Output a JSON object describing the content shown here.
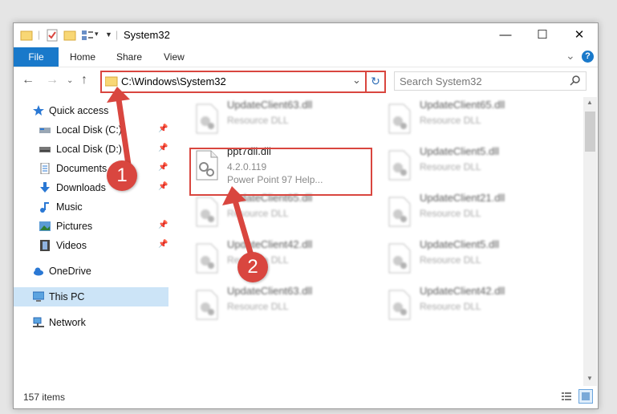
{
  "window": {
    "title": "System32",
    "controls": {
      "minimize": "—",
      "maximize": "☐",
      "close": "✕"
    }
  },
  "ribbon": {
    "tabs": [
      "File",
      "Home",
      "Share",
      "View"
    ],
    "help_label": "?",
    "collapse_label": "⌄"
  },
  "nav": {
    "address": "C:\\Windows\\System32",
    "search_placeholder": "Search System32"
  },
  "sidebar": {
    "items": [
      {
        "label": "Quick access",
        "icon": "star-icon"
      },
      {
        "label": "Local Disk (C:)",
        "icon": "drive-icon"
      },
      {
        "label": "Local Disk (D:)",
        "icon": "drive-icon"
      },
      {
        "label": "Documents",
        "icon": "documents-icon"
      },
      {
        "label": "Downloads",
        "icon": "downloads-icon"
      },
      {
        "label": "Music",
        "icon": "music-icon"
      },
      {
        "label": "Pictures",
        "icon": "pictures-icon"
      },
      {
        "label": "Videos",
        "icon": "videos-icon"
      },
      {
        "label": "OneDrive",
        "icon": "cloud-icon"
      },
      {
        "label": "This PC",
        "icon": "computer-icon"
      },
      {
        "label": "Network",
        "icon": "network-icon"
      }
    ]
  },
  "files": [
    {
      "name": "UpdateClient63.dll",
      "type": "Resource DLL"
    },
    {
      "name": "UpdateClient65.dll",
      "type": "Resource DLL"
    },
    {
      "name": "ppt7dll.dll",
      "version": "4.2.0.119",
      "desc": "Power Point 97 Help..."
    },
    {
      "name": "UpdateClient5.dll",
      "type": "Resource DLL"
    },
    {
      "name": "UpdateClient65.dll",
      "type": "Resource DLL"
    },
    {
      "name": "UpdateClient21.dll",
      "type": "Resource DLL"
    },
    {
      "name": "UpdateClient42.dll",
      "type": "Resource DLL"
    },
    {
      "name": "UpdateClient5.dll",
      "type": "Resource DLL"
    },
    {
      "name": "UpdateClient63.dll",
      "type": "Resource DLL"
    },
    {
      "name": "UpdateClient42.dll",
      "type": "Resource DLL"
    }
  ],
  "status": {
    "items_count": "157 items"
  },
  "callouts": {
    "first": "1",
    "second": "2"
  },
  "colors": {
    "accent": "#1979ca",
    "highlight": "#d9463f",
    "selection": "#cce4f7"
  }
}
